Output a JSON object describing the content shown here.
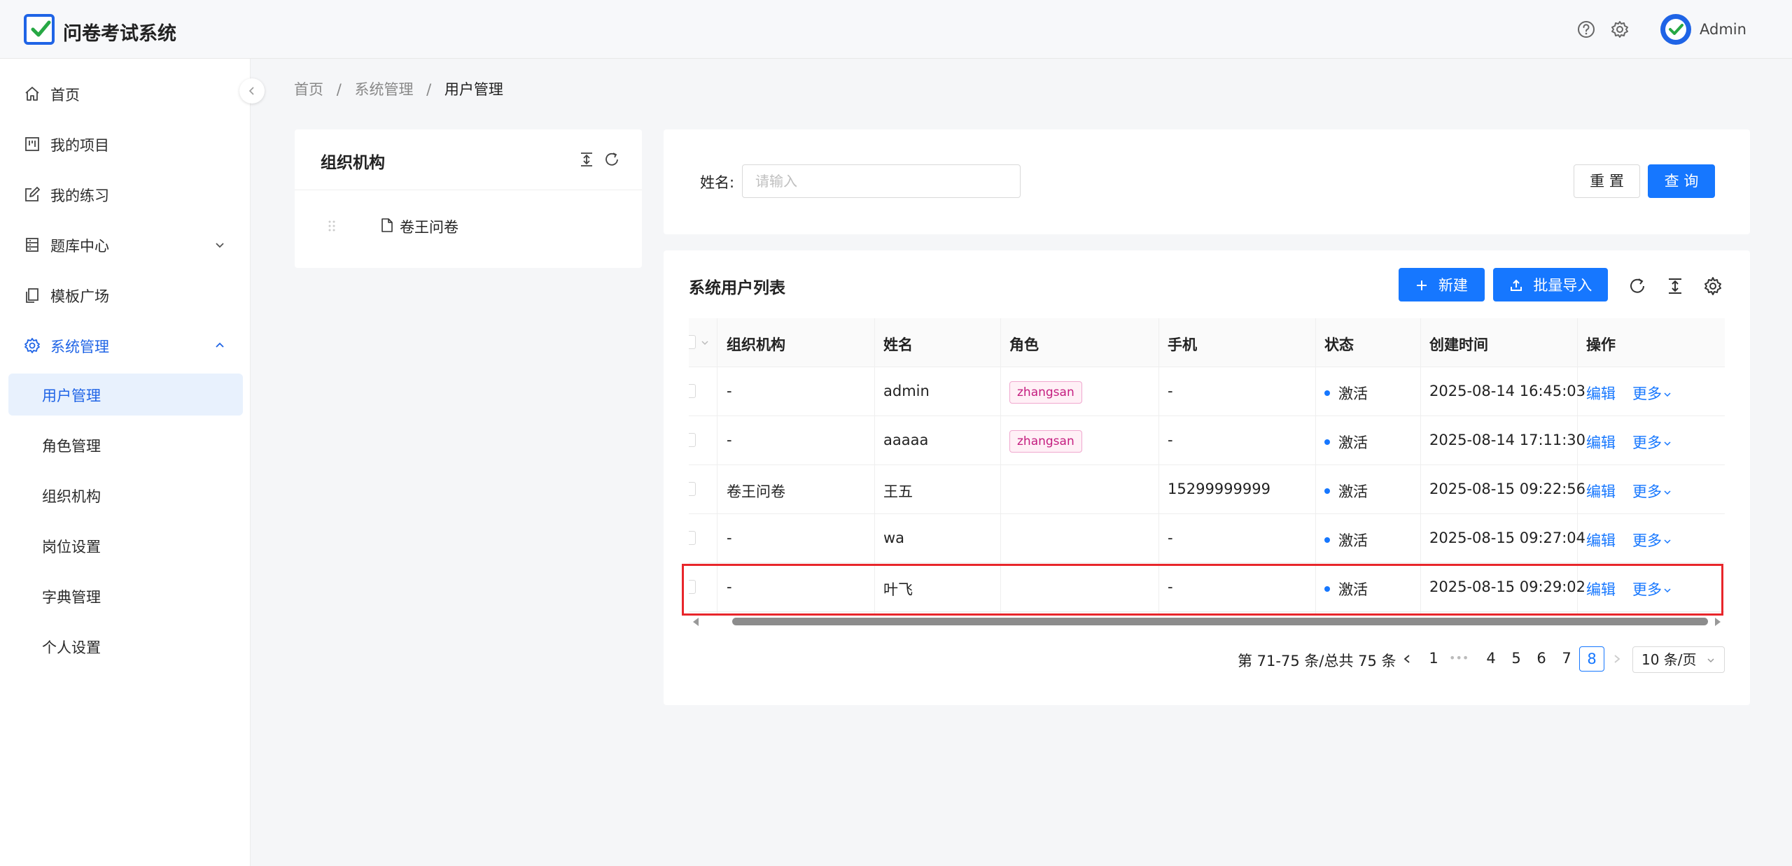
{
  "app": {
    "title": "问卷考试系统",
    "user": "Admin"
  },
  "colors": {
    "primary": "#1677ff",
    "tag_border": "#f0a8cf",
    "tag_text": "#c41d7f",
    "highlight": "#e8262b"
  },
  "sidebar": {
    "items": [
      {
        "label": "首页",
        "icon": "home-icon"
      },
      {
        "label": "我的项目",
        "icon": "project-icon"
      },
      {
        "label": "我的练习",
        "icon": "edit-icon"
      },
      {
        "label": "题库中心",
        "icon": "database-icon",
        "expandable": true
      },
      {
        "label": "模板广场",
        "icon": "copy-icon"
      },
      {
        "label": "系统管理",
        "icon": "gear-icon",
        "expanded": true
      }
    ],
    "sub_items": [
      {
        "label": "用户管理",
        "active": true
      },
      {
        "label": "角色管理"
      },
      {
        "label": "组织机构"
      },
      {
        "label": "岗位设置"
      },
      {
        "label": "字典管理"
      },
      {
        "label": "个人设置"
      }
    ]
  },
  "breadcrumb": [
    "首页",
    "系统管理",
    "用户管理"
  ],
  "breadcrumb_sep": "/",
  "org": {
    "title": "组织机构",
    "tree": [
      {
        "label": "卷王问卷"
      }
    ]
  },
  "search": {
    "label": "姓名:",
    "placeholder": "请输入",
    "value": "",
    "reset_label": "重 置",
    "query_label": "查 询"
  },
  "table": {
    "title": "系统用户列表",
    "new_label": "新建",
    "import_label": "批量导入",
    "columns": [
      "组织机构",
      "姓名",
      "角色",
      "手机",
      "状态",
      "创建时间",
      "操作"
    ],
    "rows": [
      {
        "org": "-",
        "name": "admin",
        "role": "zhangsan",
        "phone": "-",
        "status": "激活",
        "created": "2025-08-14 16:45:03"
      },
      {
        "org": "-",
        "name": "aaaaa",
        "role": "zhangsan",
        "phone": "-",
        "status": "激活",
        "created": "2025-08-14 17:11:30"
      },
      {
        "org": "卷王问卷",
        "name": "王五",
        "role": "",
        "phone": "15299999999",
        "status": "激活",
        "created": "2025-08-15 09:22:56"
      },
      {
        "org": "-",
        "name": "wa",
        "role": "",
        "phone": "-",
        "status": "激活",
        "created": "2025-08-15 09:27:04"
      },
      {
        "org": "-",
        "name": "叶飞",
        "role": "",
        "phone": "-",
        "status": "激活",
        "created": "2025-08-15 09:29:02"
      }
    ],
    "edit_label": "编辑",
    "more_label": "更多"
  },
  "pagination": {
    "total_text": "第 71-75 条/总共 75 条",
    "pages": [
      "1",
      "•••",
      "4",
      "5",
      "6",
      "7",
      "8"
    ],
    "current": "8",
    "page_size": "10 条/页"
  }
}
